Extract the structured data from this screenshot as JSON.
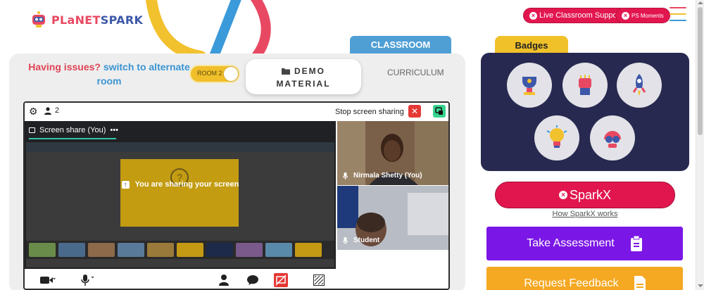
{
  "brand": {
    "name_part1": "PLaNET",
    "name_part2": "SPARK"
  },
  "header": {
    "live_support_label": "Live Classroom Support",
    "ps_moments_label": "PS Moments"
  },
  "colors": {
    "primary_red": "#e2164f",
    "classroom_blue": "#4f9fd5",
    "badge_gold": "#f1c12a",
    "badges_bg": "#282950",
    "assessment_purple": "#7b17e6",
    "feedback_orange": "#f5a822",
    "issue_red": "#e04355",
    "link_blue": "#3a95d3"
  },
  "classroom": {
    "tab_label": "CLASSROOM",
    "issues_text": "Having issues?",
    "switch_text": "switch to alternate room",
    "room_toggle_label": "ROOM 2",
    "demo_material_line1": "DEMO",
    "demo_material_line2": "MATERIAL",
    "curriculum_label": "CURRICULUM"
  },
  "meeting": {
    "participant_count": "2",
    "stop_sharing_label": "Stop screen sharing",
    "screen_share_label": "Screen share (You)",
    "sharing_message": "You are sharing your screen",
    "participants": [
      {
        "name": "Nirmala Shetty (You)"
      },
      {
        "name": "Student"
      }
    ],
    "toolbar_icons": [
      "video-icon",
      "mic-icon",
      "person-icon",
      "chat-icon",
      "screen-share-icon",
      "whiteboard-icon"
    ]
  },
  "badges": {
    "title": "Badges",
    "items": [
      "trophy-badge",
      "fist-badge",
      "rocket-badge",
      "bulb-badge",
      "goggles-badge"
    ]
  },
  "sparkx": {
    "label": "SparkX",
    "how_link": "How SparkX works"
  },
  "actions": {
    "take_assessment": "Take Assessment",
    "request_feedback": "Request Feedback"
  }
}
